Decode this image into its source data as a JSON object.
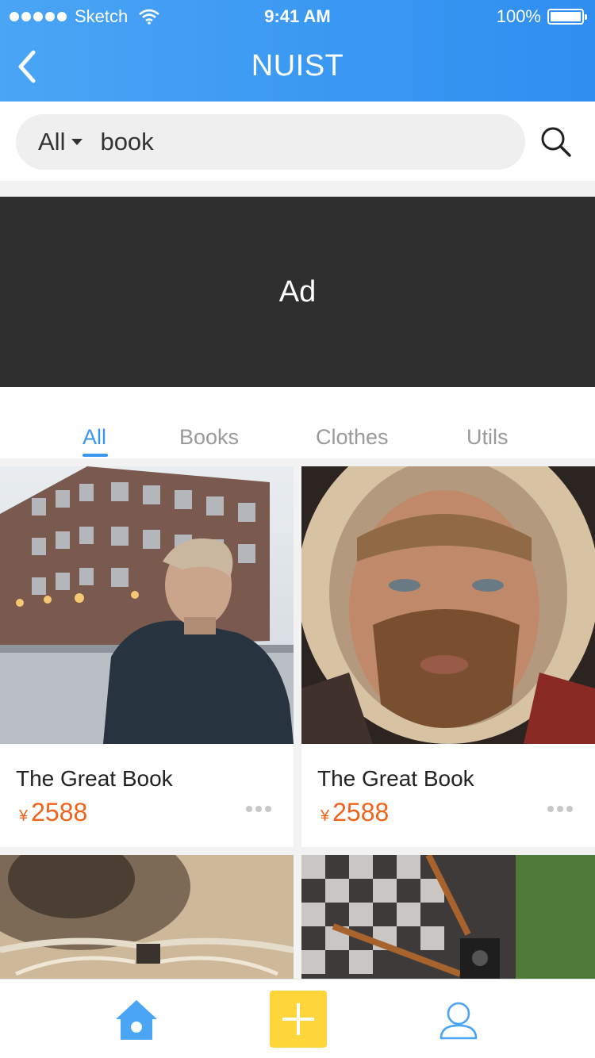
{
  "status_bar": {
    "carrier": "Sketch",
    "time": "9:41 AM",
    "battery": "100%"
  },
  "nav": {
    "title": "NUIST",
    "back_icon": "chevron-left-icon"
  },
  "search": {
    "scope": "All",
    "value": "book",
    "placeholder": "",
    "search_icon": "search-icon"
  },
  "ad": {
    "label": "Ad"
  },
  "tabs": [
    {
      "label": "All",
      "active": true
    },
    {
      "label": "Books",
      "active": false
    },
    {
      "label": "Clothes",
      "active": false
    },
    {
      "label": "Utils",
      "active": false
    }
  ],
  "products": [
    {
      "name": "The Great Book",
      "currency": "¥",
      "price": "2588",
      "image": "man-in-city-photo"
    },
    {
      "name": "The Great Book",
      "currency": "¥",
      "price": "2588",
      "image": "bearded-man-hood-photo"
    },
    {
      "name": "",
      "currency": "",
      "price": "",
      "image": "cat-glasses-photo"
    },
    {
      "name": "",
      "currency": "",
      "price": "",
      "image": "plaid-shirt-camera-photo"
    }
  ],
  "tabbar": {
    "home_icon": "home-icon",
    "add_icon": "plus-icon",
    "profile_icon": "user-icon"
  },
  "colors": {
    "header": "#3a96f0",
    "accent": "#3a96f0",
    "price": "#f0631a",
    "add_button": "#ffd63a",
    "ad_background": "#2f2f2f"
  }
}
